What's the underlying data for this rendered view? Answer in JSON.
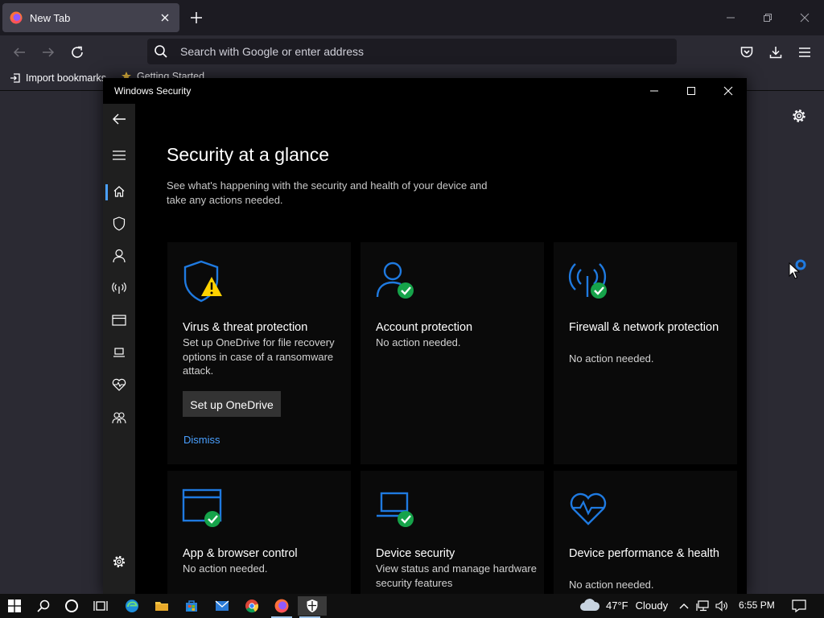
{
  "firefox": {
    "tab_title": "New Tab",
    "url_placeholder": "Search with Google or enter address",
    "bookmarks": {
      "import": "Import bookmarks...",
      "getting_started": "Getting Started"
    }
  },
  "window": {
    "title": "Windows Security"
  },
  "page": {
    "title": "Security at a glance",
    "description": "See what's happening with the security and health of your device and take any actions needed."
  },
  "cards": [
    {
      "title": "Virus & threat protection",
      "description": "Set up OneDrive for file recovery options in case of a ransomware attack.",
      "button": "Set up OneDrive",
      "link": "Dismiss",
      "icon": "shield-warning-icon",
      "status": "warning"
    },
    {
      "title": "Account protection",
      "description": "No action needed.",
      "icon": "person-check-icon",
      "status": "ok"
    },
    {
      "title": "Firewall & network protection",
      "description": "No action needed.",
      "icon": "antenna-check-icon",
      "status": "ok"
    },
    {
      "title": "App & browser control",
      "description": "No action needed.",
      "icon": "browser-window-check-icon",
      "status": "ok"
    },
    {
      "title": "Device security",
      "description": "View status and manage hardware security features",
      "icon": "laptop-check-icon",
      "status": "ok"
    },
    {
      "title": "Device performance & health",
      "description": "No action needed.",
      "icon": "heart-pulse-icon",
      "status": "ok"
    }
  ],
  "taskbar": {
    "temperature": "47°F",
    "condition": "Cloudy",
    "time": "6:55 PM"
  },
  "colors": {
    "accent": "#4aa0ff",
    "icon_blue": "#1f7ae0",
    "ok_green": "#16a34a",
    "warning_yellow": "#ffd200"
  }
}
